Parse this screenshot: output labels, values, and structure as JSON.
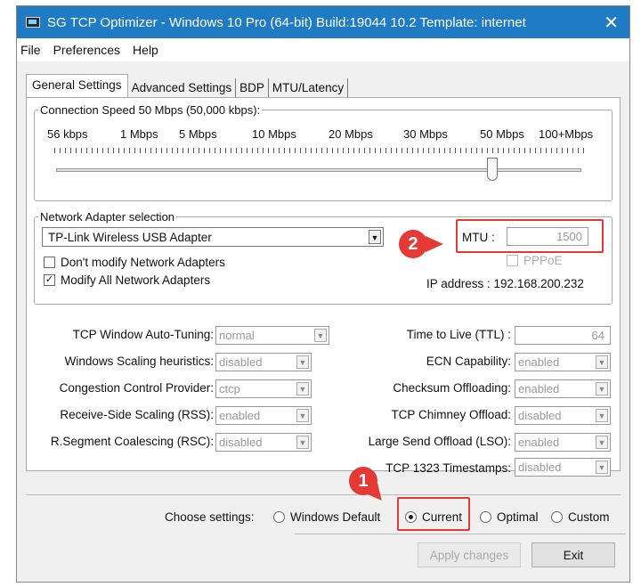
{
  "window": {
    "title": "SG TCP Optimizer - Windows 10 Pro (64-bit) Build:19044 10.2  Template: internet",
    "close_glyph": "✕",
    "app_icon": "monitor-icon"
  },
  "menu": [
    "File",
    "Preferences",
    "Help"
  ],
  "tabs": [
    "General Settings",
    "Advanced Settings",
    "BDP",
    "MTU/Latency"
  ],
  "connection": {
    "legend": "Connection Speed  50 Mbps (50,000 kbps):",
    "speeds": [
      "56 kbps",
      "1 Mbps",
      "5 Mbps",
      "10 Mbps",
      "20 Mbps",
      "30 Mbps",
      "50 Mbps",
      "100+Mbps"
    ],
    "value_mbps": 50
  },
  "adapter": {
    "legend": "Network Adapter selection",
    "selected": "TP-Link Wireless USB Adapter",
    "dont_modify": "Don't modify Network Adapters",
    "modify_all": "Modify All Network Adapters",
    "mtu_label": "MTU :",
    "mtu_value": "1500",
    "pppoe": "PPPoE",
    "ip": "IP address : 192.168.200.232"
  },
  "left_settings": [
    {
      "label": "TCP Window Auto-Tuning:",
      "value": "normal"
    },
    {
      "label": "Windows Scaling heuristics:",
      "value": "disabled"
    },
    {
      "label": "Congestion Control Provider:",
      "value": "ctcp"
    },
    {
      "label": "Receive-Side Scaling (RSS):",
      "value": "enabled"
    },
    {
      "label": "R.Segment Coalescing (RSC):",
      "value": "disabled"
    }
  ],
  "right_settings": [
    {
      "label": "Time to Live (TTL) :",
      "value": "64"
    },
    {
      "label": "ECN Capability:",
      "value": "enabled"
    },
    {
      "label": "Checksum Offloading:",
      "value": "enabled"
    },
    {
      "label": "TCP Chimney Offload:",
      "value": "disabled"
    },
    {
      "label": "Large Send Offload (LSO):",
      "value": "enabled"
    },
    {
      "label": "TCP 1323 Timestamps:",
      "value": "disabled"
    }
  ],
  "choose": {
    "label": "Choose settings:",
    "options": [
      "Windows Default",
      "Current",
      "Optimal",
      "Custom"
    ],
    "selected": "Current"
  },
  "buttons": {
    "apply": "Apply changes",
    "exit": "Exit"
  },
  "markers": {
    "one": "1",
    "two": "2"
  },
  "colors": {
    "titlebar": "#1e7bc4",
    "highlight": "#e53935"
  }
}
